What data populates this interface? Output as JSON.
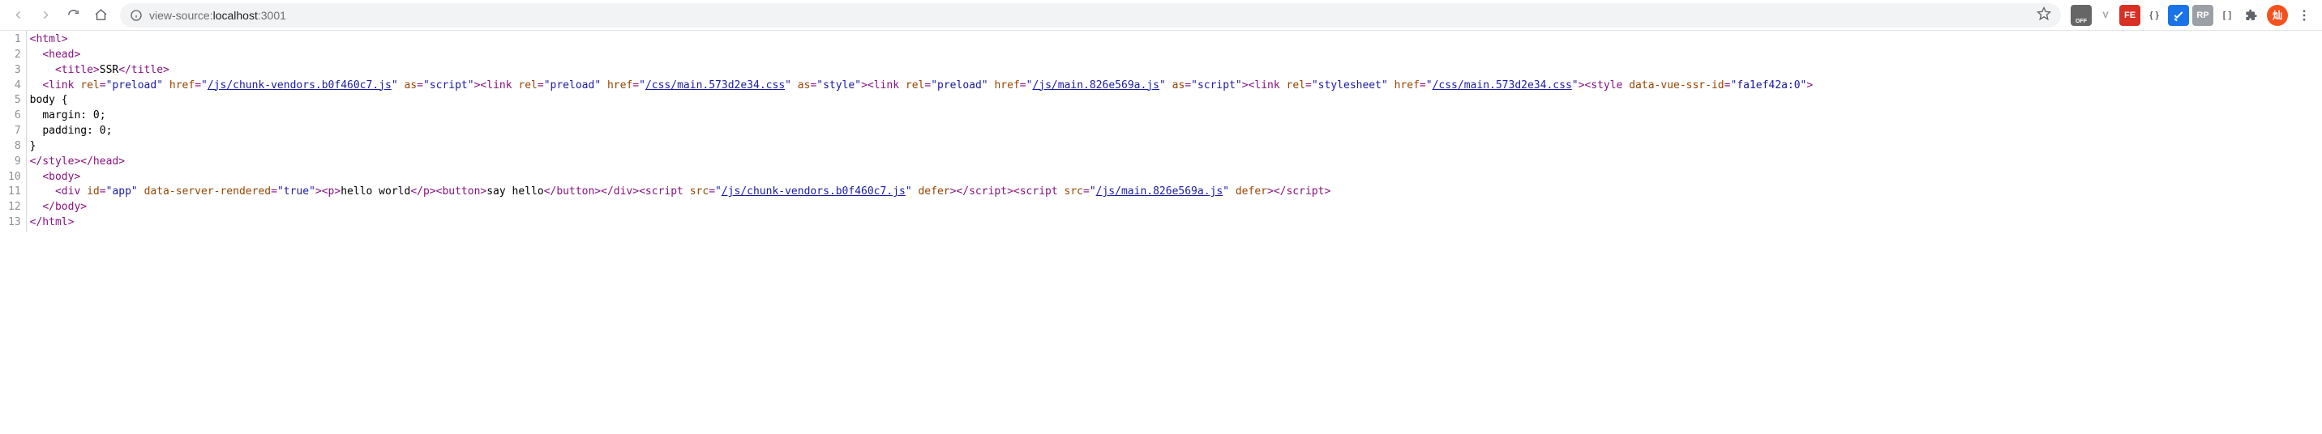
{
  "toolbar": {
    "url_prefix": "view-source:",
    "url_bold": "localhost",
    "url_suffix": ":3001"
  },
  "extensions": [
    {
      "name": "ext-hood",
      "label": "",
      "bg": "#666",
      "text": "OFF"
    },
    {
      "name": "ext-vue",
      "label": "V",
      "bg": "transparent",
      "color": "#9aa0a6"
    },
    {
      "name": "ext-fe",
      "label": "FE",
      "bg": "#d93025"
    },
    {
      "name": "ext-braces",
      "label": "{ }",
      "bg": "transparent",
      "color": "#5f6368"
    },
    {
      "name": "ext-blue",
      "label": "",
      "bg": "#1a73e8",
      "svg": "check"
    },
    {
      "name": "ext-grey",
      "label": "RP",
      "bg": "#9aa0a6"
    },
    {
      "name": "ext-bracket",
      "label": "[ ]",
      "bg": "transparent",
      "color": "#5f6368"
    },
    {
      "name": "ext-puzzle",
      "label": "",
      "bg": "transparent",
      "color": "#5f6368",
      "svg": "puzzle"
    }
  ],
  "avatar": "灿",
  "lines": [
    "1",
    "2",
    "3",
    "4",
    "5",
    "6",
    "7",
    "8",
    "9",
    "10",
    "11",
    "12",
    "13"
  ],
  "source_tokens": [
    [
      [
        "tag",
        "<html>"
      ]
    ],
    [
      [
        "text",
        "  "
      ],
      [
        "tag",
        "<head>"
      ]
    ],
    [
      [
        "text",
        "    "
      ],
      [
        "tag",
        "<title>"
      ],
      [
        "text",
        "SSR"
      ],
      [
        "tag",
        "</title>"
      ]
    ],
    [
      [
        "text",
        "  "
      ],
      [
        "tag",
        "<link "
      ],
      [
        "attr",
        "rel"
      ],
      [
        "eq",
        "="
      ],
      [
        "val",
        "\"preload\""
      ],
      [
        "tag",
        " "
      ],
      [
        "attr",
        "href"
      ],
      [
        "eq",
        "="
      ],
      [
        "val",
        "\""
      ],
      [
        "link",
        "/js/chunk-vendors.b0f460c7.js"
      ],
      [
        "val",
        "\""
      ],
      [
        "tag",
        " "
      ],
      [
        "attr",
        "as"
      ],
      [
        "eq",
        "="
      ],
      [
        "val",
        "\"script\""
      ],
      [
        "tag",
        "><link "
      ],
      [
        "attr",
        "rel"
      ],
      [
        "eq",
        "="
      ],
      [
        "val",
        "\"preload\""
      ],
      [
        "tag",
        " "
      ],
      [
        "attr",
        "href"
      ],
      [
        "eq",
        "="
      ],
      [
        "val",
        "\""
      ],
      [
        "link",
        "/css/main.573d2e34.css"
      ],
      [
        "val",
        "\""
      ],
      [
        "tag",
        " "
      ],
      [
        "attr",
        "as"
      ],
      [
        "eq",
        "="
      ],
      [
        "val",
        "\"style\""
      ],
      [
        "tag",
        "><link "
      ],
      [
        "attr",
        "rel"
      ],
      [
        "eq",
        "="
      ],
      [
        "val",
        "\"preload\""
      ],
      [
        "tag",
        " "
      ],
      [
        "attr",
        "href"
      ],
      [
        "eq",
        "="
      ],
      [
        "val",
        "\""
      ],
      [
        "link",
        "/js/main.826e569a.js"
      ],
      [
        "val",
        "\""
      ],
      [
        "tag",
        " "
      ],
      [
        "attr",
        "as"
      ],
      [
        "eq",
        "="
      ],
      [
        "val",
        "\"script\""
      ],
      [
        "tag",
        "><link "
      ],
      [
        "attr",
        "rel"
      ],
      [
        "eq",
        "="
      ],
      [
        "val",
        "\"stylesheet\""
      ],
      [
        "tag",
        " "
      ],
      [
        "attr",
        "href"
      ],
      [
        "eq",
        "="
      ],
      [
        "val",
        "\""
      ],
      [
        "link",
        "/css/main.573d2e34.css"
      ],
      [
        "val",
        "\""
      ],
      [
        "tag",
        "><style "
      ],
      [
        "attr",
        "data-vue-ssr-id"
      ],
      [
        "eq",
        "="
      ],
      [
        "val",
        "\"fa1ef42a:0\""
      ],
      [
        "tag",
        ">"
      ]
    ],
    [
      [
        "text",
        "body {"
      ]
    ],
    [
      [
        "text",
        "  margin: 0;"
      ]
    ],
    [
      [
        "text",
        "  padding: 0;"
      ]
    ],
    [
      [
        "text",
        "}"
      ]
    ],
    [
      [
        "tag",
        "</style></head>"
      ]
    ],
    [
      [
        "text",
        "  "
      ],
      [
        "tag",
        "<body>"
      ]
    ],
    [
      [
        "text",
        "    "
      ],
      [
        "tag",
        "<div "
      ],
      [
        "attr",
        "id"
      ],
      [
        "eq",
        "="
      ],
      [
        "val",
        "\"app\""
      ],
      [
        "tag",
        " "
      ],
      [
        "attr",
        "data-server-rendered"
      ],
      [
        "eq",
        "="
      ],
      [
        "val",
        "\"true\""
      ],
      [
        "tag",
        "><p>"
      ],
      [
        "text",
        "hello world"
      ],
      [
        "tag",
        "</p><button>"
      ],
      [
        "text",
        "say hello"
      ],
      [
        "tag",
        "</button></div><script "
      ],
      [
        "attr",
        "src"
      ],
      [
        "eq",
        "="
      ],
      [
        "val",
        "\""
      ],
      [
        "link",
        "/js/chunk-vendors.b0f460c7.js"
      ],
      [
        "val",
        "\""
      ],
      [
        "tag",
        " "
      ],
      [
        "attr",
        "defer"
      ],
      [
        "tag",
        "></script><script "
      ],
      [
        "attr",
        "src"
      ],
      [
        "eq",
        "="
      ],
      [
        "val",
        "\""
      ],
      [
        "link",
        "/js/main.826e569a.js"
      ],
      [
        "val",
        "\""
      ],
      [
        "tag",
        " "
      ],
      [
        "attr",
        "defer"
      ],
      [
        "tag",
        "></script>"
      ]
    ],
    [
      [
        "text",
        "  "
      ],
      [
        "tag",
        "</body>"
      ]
    ],
    [
      [
        "tag",
        "</html>"
      ]
    ]
  ]
}
